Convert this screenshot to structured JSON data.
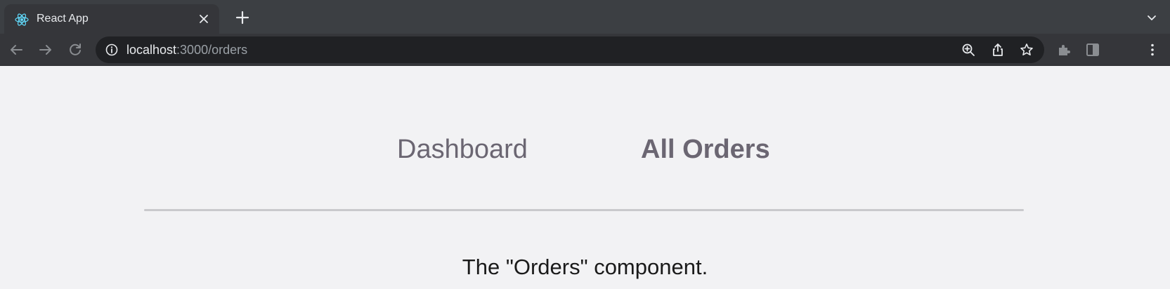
{
  "browser": {
    "tab": {
      "title": "React App",
      "favicon": "react-logo-icon"
    },
    "url": {
      "host": "localhost",
      "rest": ":3000/orders"
    },
    "toolbar_icons": [
      "back-arrow-icon",
      "forward-arrow-icon",
      "reload-icon",
      "zoom-icon",
      "share-icon",
      "star-icon",
      "extensions-icon",
      "side-panel-icon",
      "kebab-menu-icon"
    ]
  },
  "nav": {
    "dashboard_label": "Dashboard",
    "orders_label": "All Orders"
  },
  "content": {
    "text": "The \"Orders\" component."
  },
  "colors": {
    "accent_react": "#61dafb",
    "nav_text": "#6b6672",
    "page_bg": "#f2f2f4"
  }
}
